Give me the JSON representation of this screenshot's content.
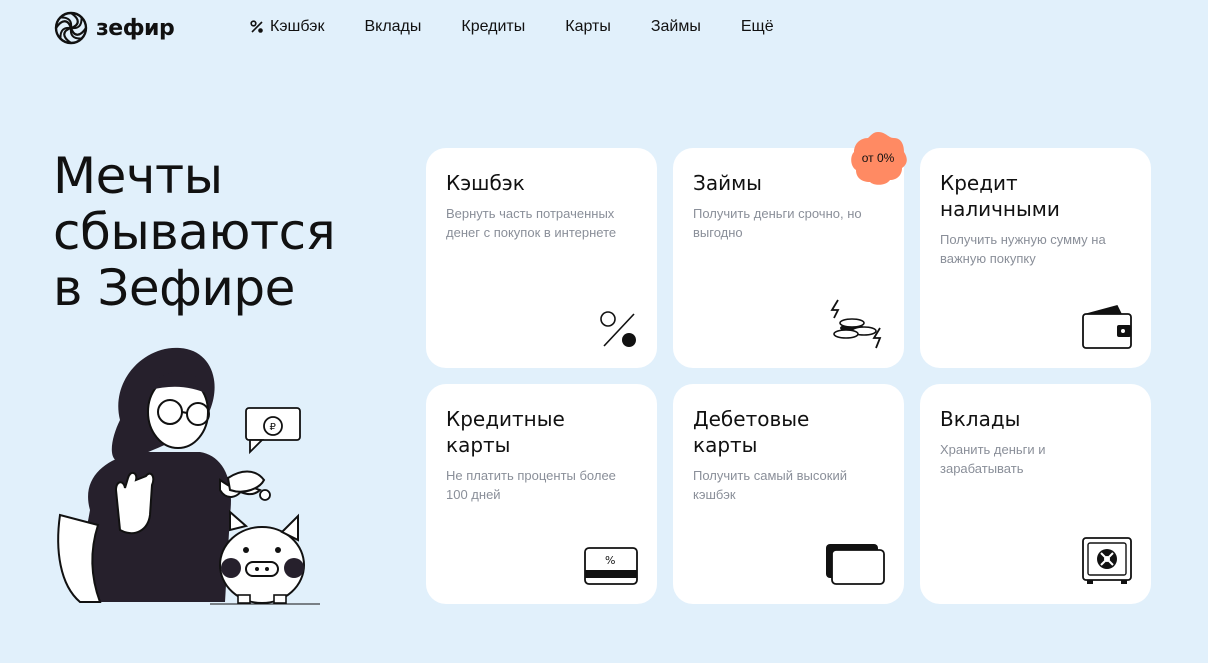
{
  "header": {
    "logo_text": "зефир",
    "nav": [
      {
        "label": "Кэшбэк",
        "icon": "percent-icon"
      },
      {
        "label": "Вклады"
      },
      {
        "label": "Кредиты"
      },
      {
        "label": "Карты"
      },
      {
        "label": "Займы"
      },
      {
        "label": "Ещё"
      }
    ]
  },
  "hero": {
    "title_lines": [
      "Мечты",
      "сбываются",
      "в Зефире"
    ]
  },
  "cards": [
    {
      "title": "Кэшбэк",
      "desc": "Вернуть часть потраченных денег с покупок в интернете",
      "icon": "percent-icon"
    },
    {
      "title": "Займы",
      "desc": "Получить деньги срочно, но выгодно",
      "icon": "coins-icon",
      "badge": "от 0%"
    },
    {
      "title": "Кредит наличными",
      "desc": "Получить нужную сумму на важную покупку",
      "icon": "wallet-icon"
    },
    {
      "title": "Кредитные карты",
      "desc": "Не платить проценты более 100 дней",
      "icon": "credit-card-icon"
    },
    {
      "title": "Дебетовые карты",
      "desc": "Получить самый высокий кэшбэк",
      "icon": "cards-icon"
    },
    {
      "title": "Вклады",
      "desc": "Хранить деньги и зарабатывать",
      "icon": "safe-icon"
    }
  ],
  "colors": {
    "background": "#e1f0fb",
    "card": "#ffffff",
    "badge": "#ff8a63",
    "text_muted": "#8a8f99"
  }
}
